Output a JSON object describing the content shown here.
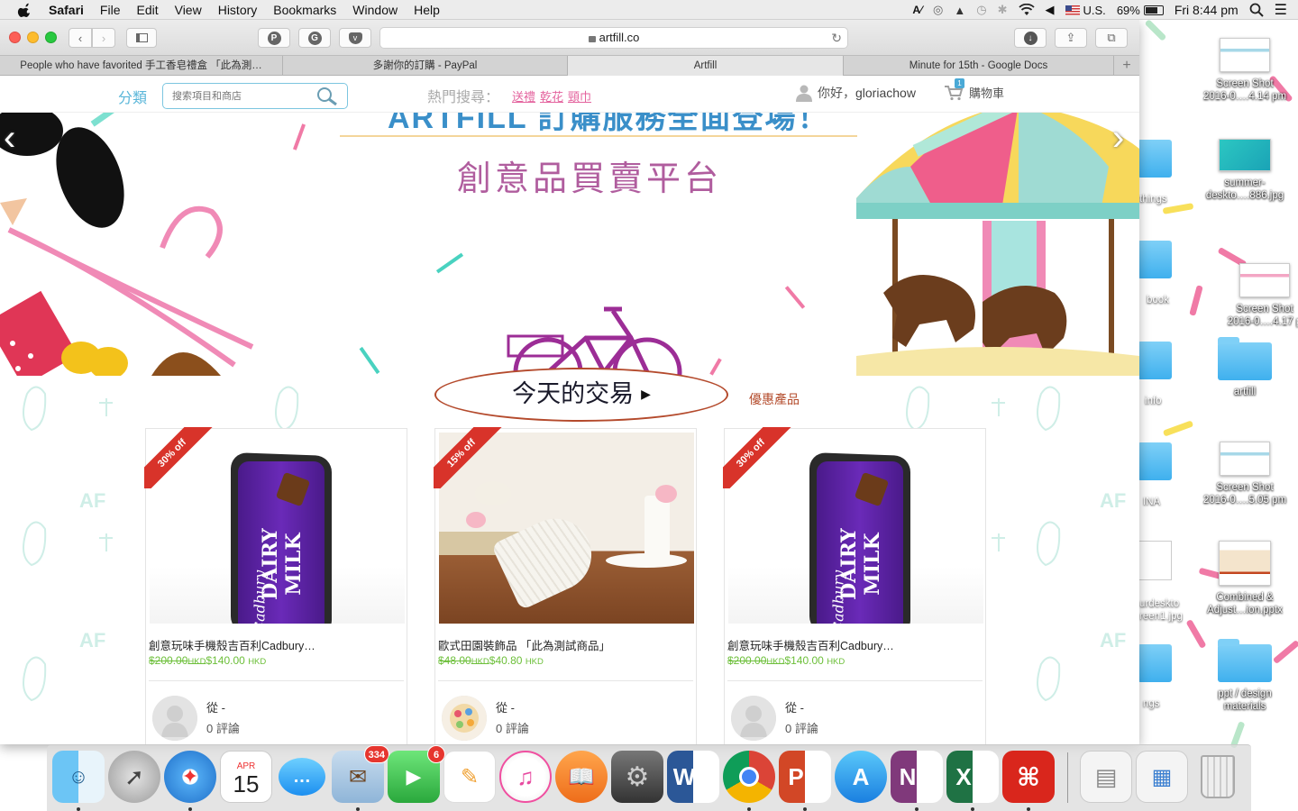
{
  "menubar": {
    "app_name": "Safari",
    "items": [
      "File",
      "Edit",
      "View",
      "History",
      "Bookmarks",
      "Window",
      "Help"
    ],
    "input_source": "U.S.",
    "battery": "69%",
    "clock": "Fri 8:44 pm"
  },
  "browser": {
    "url": "artfill.co",
    "tabs": [
      {
        "title": "People who have favorited 手工香皂禮盒 「此為測…"
      },
      {
        "title": "多謝你的訂購 - PayPal"
      },
      {
        "title": "Artfill",
        "active": true
      },
      {
        "title": "Minute for 15th - Google Docs"
      }
    ]
  },
  "site": {
    "category_label": "分類",
    "search_placeholder": "搜索項目和商店",
    "hot_label": "熱門搜尋：",
    "hot_links": [
      "送禮",
      "乾花",
      "頸巾"
    ],
    "greeting": "你好，",
    "username": "gloriachow",
    "cart_count": "1",
    "cart_label": "購物車"
  },
  "banner": {
    "partial_title": "ARTFILL 訂購服務全面登場！",
    "subtitle": "創意品買賣平台"
  },
  "deals": {
    "title": "今天的交易",
    "link": "優惠產品",
    "products": [
      {
        "badge": "30% off",
        "name": "創意玩味手機殼吉百利Cadbury…",
        "old_price": "$200.00",
        "old_currency": "HKD",
        "price": "$140.00",
        "currency": "HKD",
        "from": "從 -",
        "reviews": "0 評論",
        "image": "purple-phone-case"
      },
      {
        "badge": "15% off",
        "name": "歐式田園裝飾品 「此為測試商品」",
        "old_price": "$48.00",
        "old_currency": "HKD",
        "price": "$40.80",
        "currency": "HKD",
        "from": "從 -",
        "reviews": "0 評論",
        "image": "white-cup-decor"
      },
      {
        "badge": "30% off",
        "name": "創意玩味手機殼吉百利Cadbury…",
        "old_price": "$200.00",
        "old_currency": "HKD",
        "price": "$140.00",
        "currency": "HKD",
        "from": "從 -",
        "reviews": "0 評論",
        "image": "purple-phone-case"
      }
    ],
    "phone_case_text": "DAIRY MILK",
    "phone_case_brand": "Cadbury"
  },
  "desktop_icons": [
    {
      "label": "Screen Shot 2016-0….4.14 pm",
      "type": "screenshot"
    },
    {
      "label": "summer-deskto….886.jpg",
      "type": "image"
    },
    {
      "label": "Screen Shot 2016-0….4.17 p",
      "type": "screenshot"
    },
    {
      "label": "artfill",
      "type": "folder"
    },
    {
      "label": "Screen Shot 2016-0….5.05 pm",
      "type": "screenshot"
    },
    {
      "label": "Combined & Adjust…ion.pptx",
      "type": "pptx"
    },
    {
      "label": "ppt / design materials",
      "type": "folder"
    }
  ],
  "desktop_partial_labels": [
    "things",
    "book",
    "info",
    "INA",
    "urdeskto reen1.jpg",
    "ngs"
  ],
  "dock": {
    "calendar_month": "APR",
    "calendar_day": "15",
    "mail_badge": "334",
    "facetime_badge": "6",
    "apps": [
      "Finder",
      "Launchpad",
      "Safari",
      "Calendar",
      "Messages",
      "Mail",
      "FaceTime",
      "Pages",
      "iTunes",
      "iBooks",
      "System Preferences",
      "Word",
      "Chrome",
      "PowerPoint",
      "App Store",
      "OneNote",
      "Excel",
      "Acrobat",
      "Documents",
      "Downloads",
      "Trash"
    ]
  }
}
